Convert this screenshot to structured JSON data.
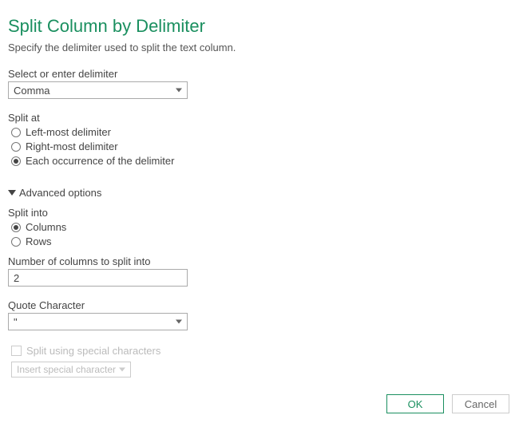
{
  "title": "Split Column by Delimiter",
  "subtitle": "Specify the delimiter used to split the text column.",
  "delimiter": {
    "label": "Select or enter delimiter",
    "value": "Comma"
  },
  "split_at": {
    "label": "Split at",
    "options": [
      {
        "label": "Left-most delimiter",
        "checked": false
      },
      {
        "label": "Right-most delimiter",
        "checked": false
      },
      {
        "label": "Each occurrence of the delimiter",
        "checked": true
      }
    ]
  },
  "advanced": {
    "header": "Advanced options",
    "split_into": {
      "label": "Split into",
      "options": [
        {
          "label": "Columns",
          "checked": true
        },
        {
          "label": "Rows",
          "checked": false
        }
      ]
    },
    "num_columns": {
      "label": "Number of columns to split into",
      "value": "2"
    },
    "quote_char": {
      "label": "Quote Character",
      "value": "\""
    },
    "special": {
      "label": "Split using special characters",
      "insert": "Insert special character"
    }
  },
  "buttons": {
    "ok": "OK",
    "cancel": "Cancel"
  }
}
